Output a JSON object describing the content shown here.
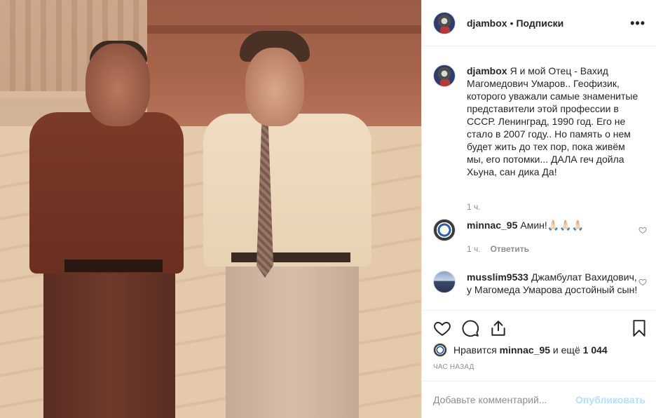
{
  "post": {
    "author": "djambox",
    "follow_label": "Подписки",
    "caption": "Я и мой Отец - Вахид Магомедович Умаров.. Геофизик, которого уважали самые знаменитые представители этой профессии в СССР. Ленинград, 1990 год. Его не стало в 2007 году.. Но память о нем будет жить до тех пор, пока живём мы, его потомки... ДАЛА геч дойла Хьуна, сан дика Да!",
    "caption_time": "1 ч."
  },
  "comments": [
    {
      "author": "minnac_95",
      "text": "Амин!🙏🏻🙏🏻🙏🏻",
      "time": "1 ч.",
      "reply_label": "Ответить"
    },
    {
      "author": "musslim9533",
      "text": "Джамбулат Вахидович, у Магомеда Умарова достойный сын!"
    }
  ],
  "likes": {
    "prefix": "Нравится ",
    "user": "minnac_95",
    "middle": " и ещё ",
    "count": "1 044"
  },
  "time_ago": "ЧАС НАЗАД",
  "add_comment": {
    "placeholder": "Добавьте комментарий...",
    "post_label": "Опубликовать"
  },
  "icons": {
    "more": "more-options-icon",
    "like": "heart-icon",
    "comment": "comment-icon",
    "share": "share-icon",
    "save": "bookmark-icon"
  },
  "colors": {
    "text": "#262626",
    "secondary": "#8e8e8e",
    "border": "#efefef",
    "post_button_disabled": "#b2dffc"
  }
}
